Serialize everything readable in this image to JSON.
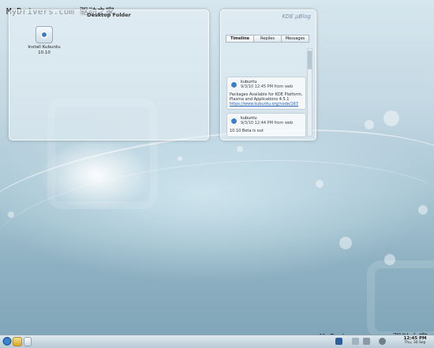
{
  "watermark": {
    "text": "MyDrivers.com 驱动之家"
  },
  "folder_view": {
    "title": "Desktop Folder",
    "icons": [
      {
        "label": "Install Kubuntu 10.10",
        "icon": "installer-icon"
      }
    ]
  },
  "microblog": {
    "brand": "KDE µBlog",
    "tabs": [
      "Timeline",
      "Replies",
      "Messages"
    ],
    "active_tab": "Timeline",
    "posts": [
      {
        "user": "kubuntu",
        "time": "9/3/10 12:45 PM from web",
        "text": "Packages Available for KDE Platform, Plasma and Applications 4.5.1",
        "link": "https://www.kubuntu.org/node/167"
      },
      {
        "user": "kubuntu",
        "time": "9/3/10 12:44 PM from web",
        "text": "10.10 Beta is out",
        "link": ""
      }
    ]
  },
  "taskbar": {
    "clock_time": "12:45 PM",
    "clock_date": "Thu, 30 Sep"
  },
  "colors": {
    "accent": "#3b80c6",
    "taskbar": "#c8d7e0"
  }
}
